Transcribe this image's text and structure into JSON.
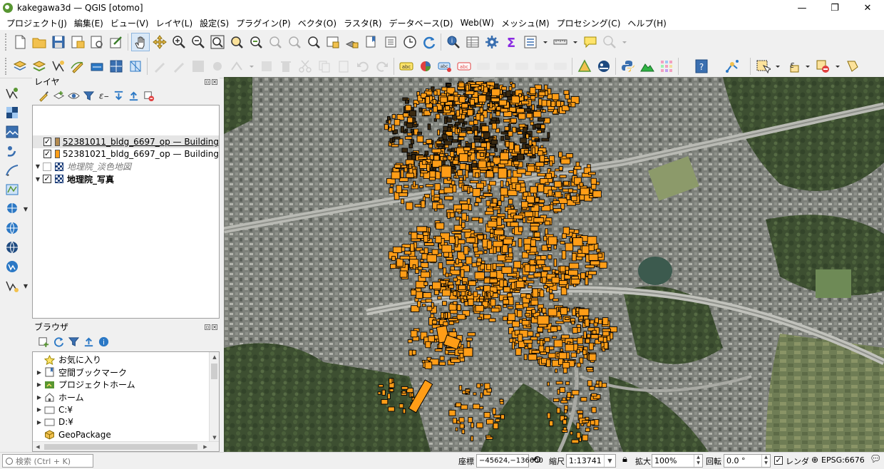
{
  "window": {
    "title": "kakegawa3d — QGIS [otomo]",
    "minimize": "—",
    "maximize": "❐",
    "close": "✕"
  },
  "menu": {
    "items": [
      "プロジェクト(J)",
      "編集(E)",
      "ビュー(V)",
      "レイヤ(L)",
      "設定(S)",
      "プラグイン(P)",
      "ベクタ(O)",
      "ラスタ(R)",
      "データベース(D)",
      "Web(W)",
      "メッシュ(M)",
      "プロセシング(C)",
      "ヘルプ(H)"
    ]
  },
  "layers_panel": {
    "title": "レイヤ",
    "layers": [
      {
        "name": "52381011_bldg_6697_op — Building",
        "checked": true,
        "color": "#b38a4e",
        "style": "underline",
        "selected": true
      },
      {
        "name": "52381021_bldg_6697_op — Building",
        "checked": true,
        "color": "#ff9d17",
        "style": "normal",
        "selected": false
      },
      {
        "name": "地理院_淡色地図",
        "checked": false,
        "style": "italic",
        "expanded": true
      },
      {
        "name": "地理院_写真",
        "checked": true,
        "style": "bold",
        "expanded": true
      }
    ]
  },
  "browser_panel": {
    "title": "ブラウザ",
    "items": [
      {
        "label": "お気に入り",
        "icon": "star-icon",
        "expandable": false
      },
      {
        "label": "空間ブックマーク",
        "icon": "bookmark-icon",
        "expandable": true
      },
      {
        "label": "プロジェクトホーム",
        "icon": "project-home-icon",
        "expandable": true
      },
      {
        "label": "ホーム",
        "icon": "home-icon",
        "expandable": true
      },
      {
        "label": "C:¥",
        "icon": "drive-icon",
        "expandable": true
      },
      {
        "label": "D:¥",
        "icon": "drive-icon",
        "expandable": true
      },
      {
        "label": "GeoPackage",
        "icon": "geopackage-icon",
        "expandable": false
      }
    ]
  },
  "status": {
    "locator_placeholder": "検索 (Ctrl + K)",
    "coordinate_label": "座標",
    "coordinate_value": "−45624,−136600",
    "scale_label": "縮尺",
    "scale_value": "1:13741",
    "magnifier_label": "拡大",
    "magnifier_value": "100%",
    "rotation_label": "回転",
    "rotation_value": "0.0 °",
    "render_label": "レンダ",
    "render_checked": "✓",
    "crs": "EPSG:6676"
  },
  "colors": {
    "building_fill": "#ff9d17",
    "building_outline": "#000000",
    "building_other": "#b38a4e"
  }
}
